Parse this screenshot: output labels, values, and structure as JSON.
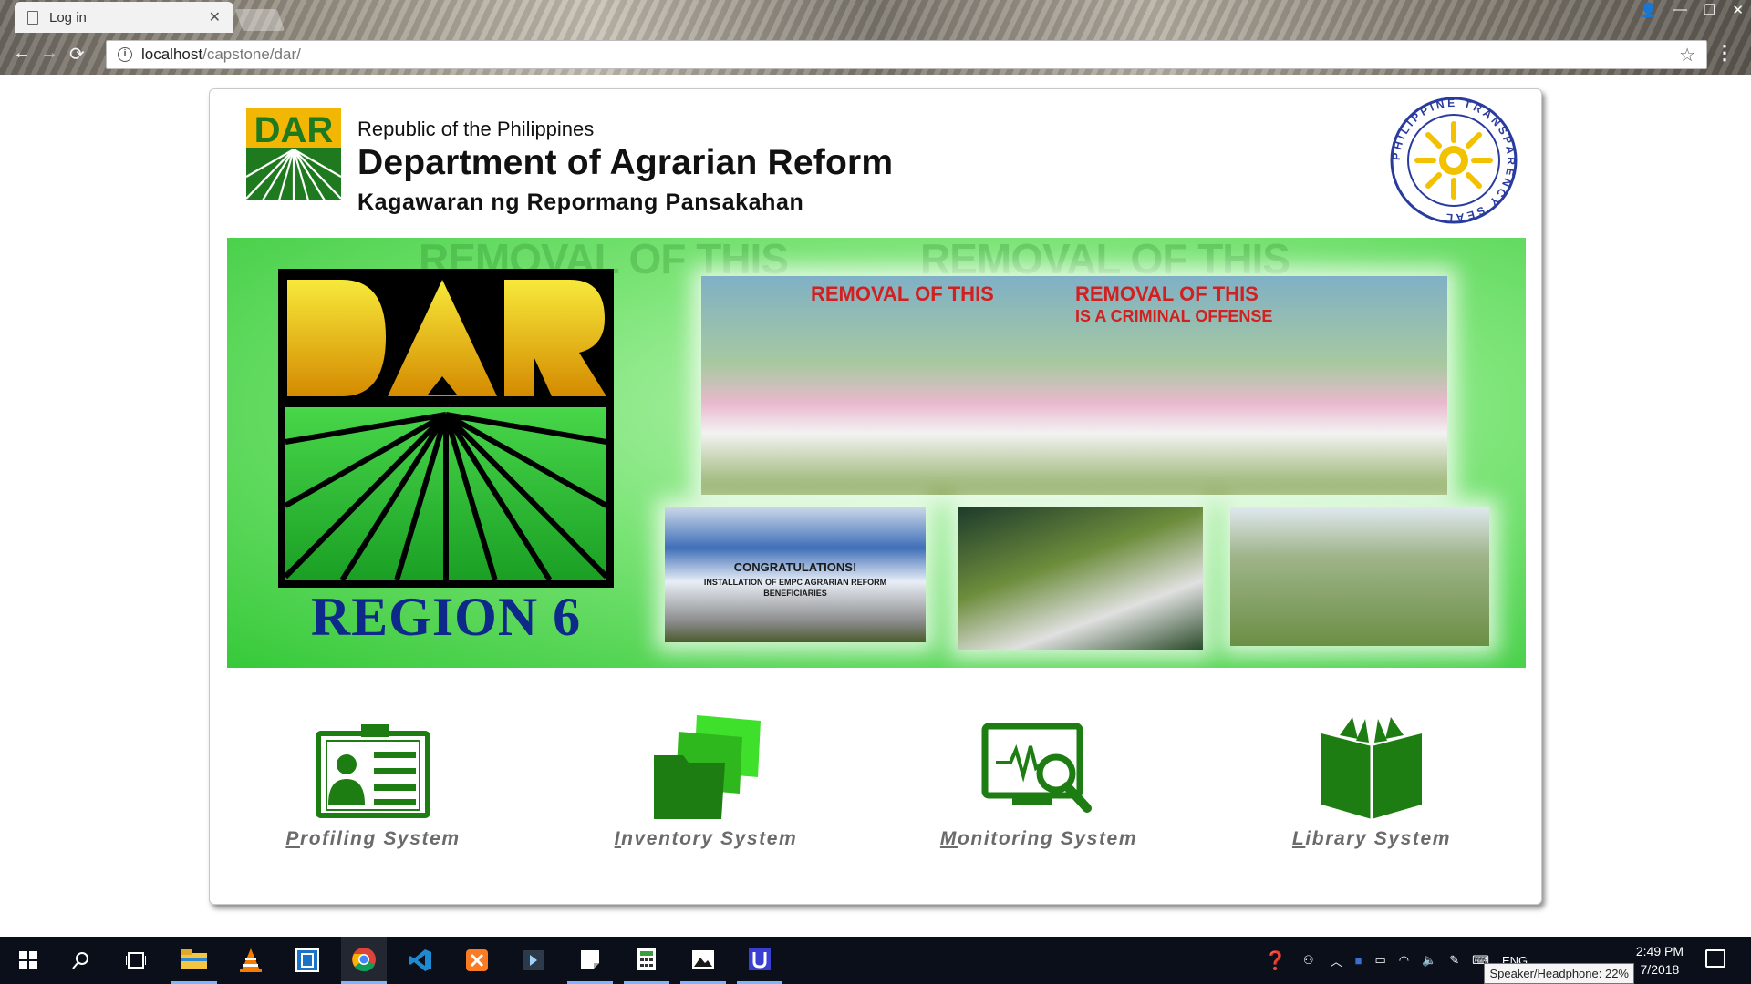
{
  "browser": {
    "tab_title": "Log in",
    "url_host": "localhost",
    "url_path": "/capstone/dar/"
  },
  "header": {
    "subtitle": "Republic of the Philippines",
    "title": "Department of Agrarian Reform",
    "tagalog": "Kagawaran ng Repormang Pansakahan",
    "logo_text": "DAR",
    "seal_text": "PHILIPPINE TRANSPARENCY SEAL"
  },
  "banner": {
    "region_label": "REGION 6",
    "sign_text_1": "REMOVAL OF THIS",
    "sign_text_2": "IS A CRIMINAL OFFENSE",
    "congrats_title": "CONGRATULATIONS!",
    "congrats_sub": "INSTALLATION OF EMPC AGRARIAN REFORM BENEFICIARIES"
  },
  "systems": [
    {
      "accel": "P",
      "rest": "rofiling System",
      "icon": "id-card-icon"
    },
    {
      "accel": "I",
      "rest": "nventory System",
      "icon": "folders-icon"
    },
    {
      "accel": "M",
      "rest": "onitoring System",
      "icon": "monitor-search-icon"
    },
    {
      "accel": "L",
      "rest": "ibrary System",
      "icon": "book-icon"
    }
  ],
  "taskbar": {
    "time": "2:49 PM",
    "date": "7/2018",
    "lang": "ENG",
    "tooltip": "Speaker/Headphone: 22%"
  },
  "colors": {
    "dar_green": "#1f7a1f",
    "icon_green": "#1e7d12",
    "bright_green": "#3fe02b",
    "region_blue": "#0d2a8a",
    "label_gray": "#6b6b6b"
  }
}
